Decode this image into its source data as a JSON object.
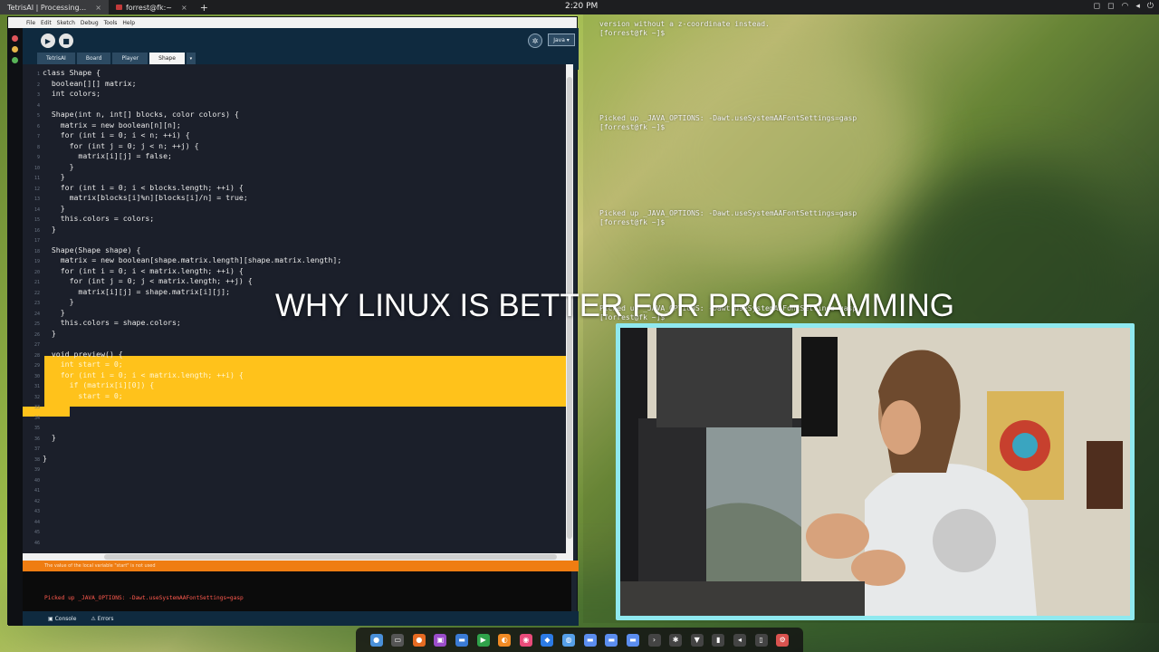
{
  "topbar": {
    "tabs": [
      {
        "label": "TetrisAI | Processing..."
      },
      {
        "label": "forrest@fk:~"
      }
    ],
    "new_tab": "+",
    "close_glyph": "×",
    "clock": "2:20 PM"
  },
  "ide": {
    "menu": [
      "File",
      "Edit",
      "Sketch",
      "Debug",
      "Tools",
      "Help"
    ],
    "mode": "Java ▾",
    "tabs": [
      "TetrisAI",
      "Board",
      "Player",
      "Shape"
    ],
    "active_tab": "Shape",
    "code_lines": [
      "class Shape {",
      "  boolean[][] matrix;",
      "  int colors;",
      "",
      "  Shape(int n, int[] blocks, color colors) {",
      "    matrix = new boolean[n][n];",
      "    for (int i = 0; i < n; ++i) {",
      "      for (int j = 0; j < n; ++j) {",
      "        matrix[i][j] = false;",
      "      }",
      "    }",
      "    for (int i = 0; i < blocks.length; ++i) {",
      "      matrix[blocks[i]%n][blocks[i]/n] = true;",
      "    }",
      "    this.colors = colors;",
      "  }",
      "",
      "  Shape(Shape shape) {",
      "    matrix = new boolean[shape.matrix.length][shape.matrix.length];",
      "    for (int i = 0; i < matrix.length; ++i) {",
      "      for (int j = 0; j < matrix.length; ++j) {",
      "        matrix[i][j] = shape.matrix[i][j];",
      "      }",
      "    }",
      "    this.colors = shape.colors;",
      "  }",
      "",
      "  void preview() {",
      "    int start = 0;",
      "    for (int i = 0; i < matrix.length; ++i) {",
      "      if (matrix[i][0]) {",
      "        start = 0;",
      "",
      "",
      "",
      "  }",
      "",
      "}"
    ],
    "line_numbers": [
      "1",
      "2",
      "3",
      "4",
      "5",
      "6",
      "7",
      "8",
      "9",
      "10",
      "11",
      "12",
      "13",
      "14",
      "15",
      "16",
      "17",
      "18",
      "19",
      "20",
      "21",
      "22",
      "23",
      "24",
      "25",
      "26",
      "27",
      "28",
      "29",
      "30",
      "31",
      "32",
      "33",
      "34",
      "35",
      "36",
      "37",
      "38",
      "39",
      "40",
      "41",
      "42",
      "43",
      "44",
      "45",
      "46"
    ],
    "status_message": "The value of the local variable \"start\" is not used",
    "console_text": "Picked up _JAVA_OPTIONS: -Dawt.useSystemAAFontSettings=gasp",
    "console_tab": "Console",
    "errors_tab": "Errors"
  },
  "terminal": {
    "lines": [
      "version without a z-coordinate instead.",
      "[forrest@fk ~]$",
      "Picked up _JAVA_OPTIONS: -Dawt.useSystemAAFontSettings=gasp",
      "[forrest@fk ~]$",
      "Picked up _JAVA_OPTIONS: -Dawt.useSystemAAFontSettings=gasp",
      "[forrest@fk ~]$",
      "Picked up _JAVA_OPTIONS: -Dawt.useSystemAAFontSettings=gasp",
      "[forrest@fk ~]$"
    ]
  },
  "headline": "WHY LINUX IS BETTER FOR PROGRAMMING",
  "colors": {
    "highlight": "#ffc21b",
    "status_bar": "#ef7d12",
    "webcam_border": "#8fe9ef",
    "editor_bg": "#1b1f2a"
  },
  "dock": {
    "icons": [
      "chrome-icon",
      "terminal-icon",
      "firefox-icon",
      "app-icon",
      "folder-icon",
      "monitor-icon",
      "blender-icon",
      "color-icon",
      "cube-icon",
      "browser-icon",
      "folder-icon",
      "folder-icon",
      "folder-icon",
      "code-icon",
      "bluetooth-icon",
      "wifi-icon",
      "battery-icon",
      "volume-icon",
      "notes-icon",
      "settings-icon"
    ]
  }
}
